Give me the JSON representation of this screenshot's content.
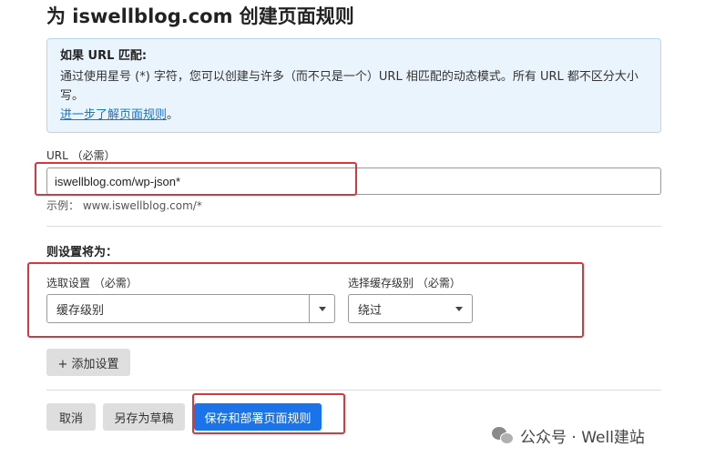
{
  "page": {
    "title": "为 iswellblog.com 创建页面规则"
  },
  "info": {
    "title": "如果 URL 匹配:",
    "text": "通过使用星号 (*) 字符，您可以创建与许多（而不只是一个）URL 相匹配的动态模式。所有 URL 都不区分大小写。",
    "link_label": "进一步了解页面规则",
    "link_suffix": "。"
  },
  "url_field": {
    "label": "URL （必需）",
    "value": "iswellblog.com/wp-json*",
    "example": "示例： www.iswellblog.com/*"
  },
  "settings": {
    "section_title": "则设置将为：",
    "setting_label": "选取设置 （必需）",
    "setting_value": "缓存级别",
    "cache_label": "选择缓存级别 （必需）",
    "cache_value": "绕过",
    "add_label": "+ 添加设置"
  },
  "actions": {
    "cancel_label": "取消",
    "draft_label": "另存为草稿",
    "deploy_label": "保存和部署页面规则"
  },
  "watermark": {
    "text": "公众号 · Well建站"
  },
  "colors": {
    "primary": "#1a73e8",
    "highlight": "#d9363e",
    "info_bg": "#eaf4fc"
  }
}
